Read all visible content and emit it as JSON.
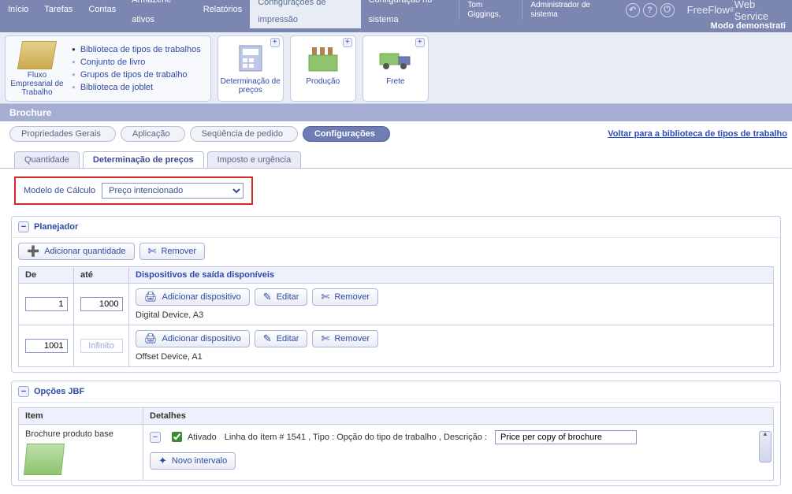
{
  "topmenu": {
    "items": [
      {
        "label": "Início"
      },
      {
        "label": "Tarefas"
      },
      {
        "label": "Contas"
      },
      {
        "label": "Armazene ativos"
      },
      {
        "label": "Relatórios"
      },
      {
        "label": "Configurações de impressão",
        "active": true
      },
      {
        "label": "Configuração no sistema"
      }
    ]
  },
  "user": {
    "name": "Tom Giggings,",
    "role": "Administrador de sistema"
  },
  "brand": {
    "text": "FreeFlow",
    "suffix": " Web Service",
    "super": "®"
  },
  "demo_mode": "Modo demonstrati",
  "ribbon": {
    "workflow": {
      "l1": "Fluxo",
      "l2": "Empresarial de",
      "l3": "Trabalho"
    },
    "links": [
      {
        "label": "Biblioteca de tipos de trabalhos",
        "selected": true
      },
      {
        "label": "Conjunto de livro"
      },
      {
        "label": "Grupos de tipos de trabalho"
      },
      {
        "label": "Biblioteca de joblet"
      }
    ],
    "tiles": [
      {
        "l1": "Determinação de",
        "l2": "preços"
      },
      {
        "l1": "Produção",
        "l2": ""
      },
      {
        "l1": "Frete",
        "l2": ""
      }
    ]
  },
  "title": "Brochure",
  "crumbs": [
    {
      "label": "Propriedades Gerais"
    },
    {
      "label": "Aplicação"
    },
    {
      "label": "Seqüência de pedido"
    },
    {
      "label": "Configurações",
      "active": true
    }
  ],
  "liblink": "Voltar para a biblioteca de tipos de trabalho",
  "innertabs": [
    {
      "label": "Quantidade"
    },
    {
      "label": "Determinação de preços",
      "active": true
    },
    {
      "label": "Imposto e urgência"
    }
  ],
  "calc": {
    "label": "Modelo de Cálculo",
    "value": "Preço intencionado"
  },
  "planner": {
    "title": "Planejador",
    "buttons": {
      "addqty": "Adicionar quantidade",
      "remove": "Remover",
      "adddev": "Adicionar dispositivo",
      "edit": "Editar",
      "removedev": "Remover"
    },
    "headers": {
      "from": "De",
      "to": "até",
      "devices": "Dispositivos de saída disponíveis"
    },
    "rows": [
      {
        "from": "1",
        "to": "1000",
        "device": "Digital Device, A3"
      },
      {
        "from": "1001",
        "to": "Infinito",
        "to_ro": true,
        "device": "Offset Device, A1"
      }
    ]
  },
  "jbf": {
    "title": "Opções JBF",
    "headers": {
      "item": "Item",
      "details": "Detalhes"
    },
    "item_name": "Brochure produto base",
    "active_label": "Ativado",
    "itemline_prefix": "Linha do ítem # ",
    "itemline_num": "1541",
    "itemline_mid": " , Tipo : Opção do tipo de trabalho , Descrição : ",
    "desc_value": "Price per copy of brochure",
    "new_interval": "Novo intervalo"
  }
}
